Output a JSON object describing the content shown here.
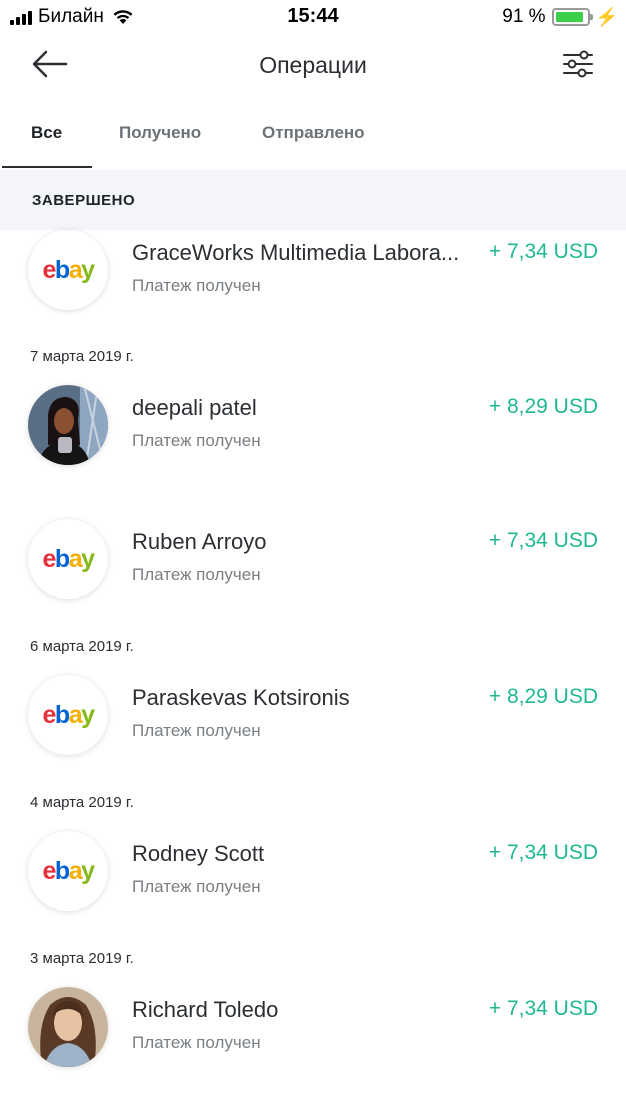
{
  "status_bar": {
    "carrier": "Билайн",
    "time": "15:44",
    "battery_text": "91 %",
    "battery_level": 0.91,
    "battery_color": "#3ecf4a"
  },
  "nav": {
    "title": "Операции",
    "back_icon": "arrow-left-icon",
    "filter_icon": "sliders-icon"
  },
  "tabs": [
    {
      "label": "Все",
      "active": true
    },
    {
      "label": "Получено",
      "active": false
    },
    {
      "label": "Отправлено",
      "active": false
    }
  ],
  "section": {
    "label": "ЗАВЕРШЕНО"
  },
  "accent_color": "#1fb891",
  "groups": [
    {
      "date": "",
      "items": [
        {
          "name": "GraceWorks Multimedia Labora...",
          "status": "Платеж получен",
          "amount": "+ 7,34 USD",
          "avatar": "ebay-logo"
        }
      ]
    },
    {
      "date": "7 марта 2019 г.",
      "items": [
        {
          "name": "deepali patel",
          "status": "Платеж получен",
          "amount": "+ 8,29 USD",
          "avatar": "photo"
        },
        {
          "name": "Ruben Arroyo",
          "status": "Платеж получен",
          "amount": "+ 7,34 USD",
          "avatar": "ebay-logo"
        }
      ]
    },
    {
      "date": "6 марта 2019 г.",
      "items": [
        {
          "name": "Paraskevas Kotsironis",
          "status": "Платеж получен",
          "amount": "+ 8,29 USD",
          "avatar": "ebay-logo"
        }
      ]
    },
    {
      "date": "4 марта 2019 г.",
      "items": [
        {
          "name": "Rodney Scott",
          "status": "Платеж получен",
          "amount": "+ 7,34 USD",
          "avatar": "ebay-logo"
        }
      ]
    },
    {
      "date": "3 марта 2019 г.",
      "items": [
        {
          "name": "Richard Toledo",
          "status": "Платеж получен",
          "amount": "+ 7,34 USD",
          "avatar": "photo"
        }
      ]
    }
  ],
  "ebay_logo": {
    "e": "e",
    "b": "b",
    "a": "a",
    "y": "y"
  }
}
